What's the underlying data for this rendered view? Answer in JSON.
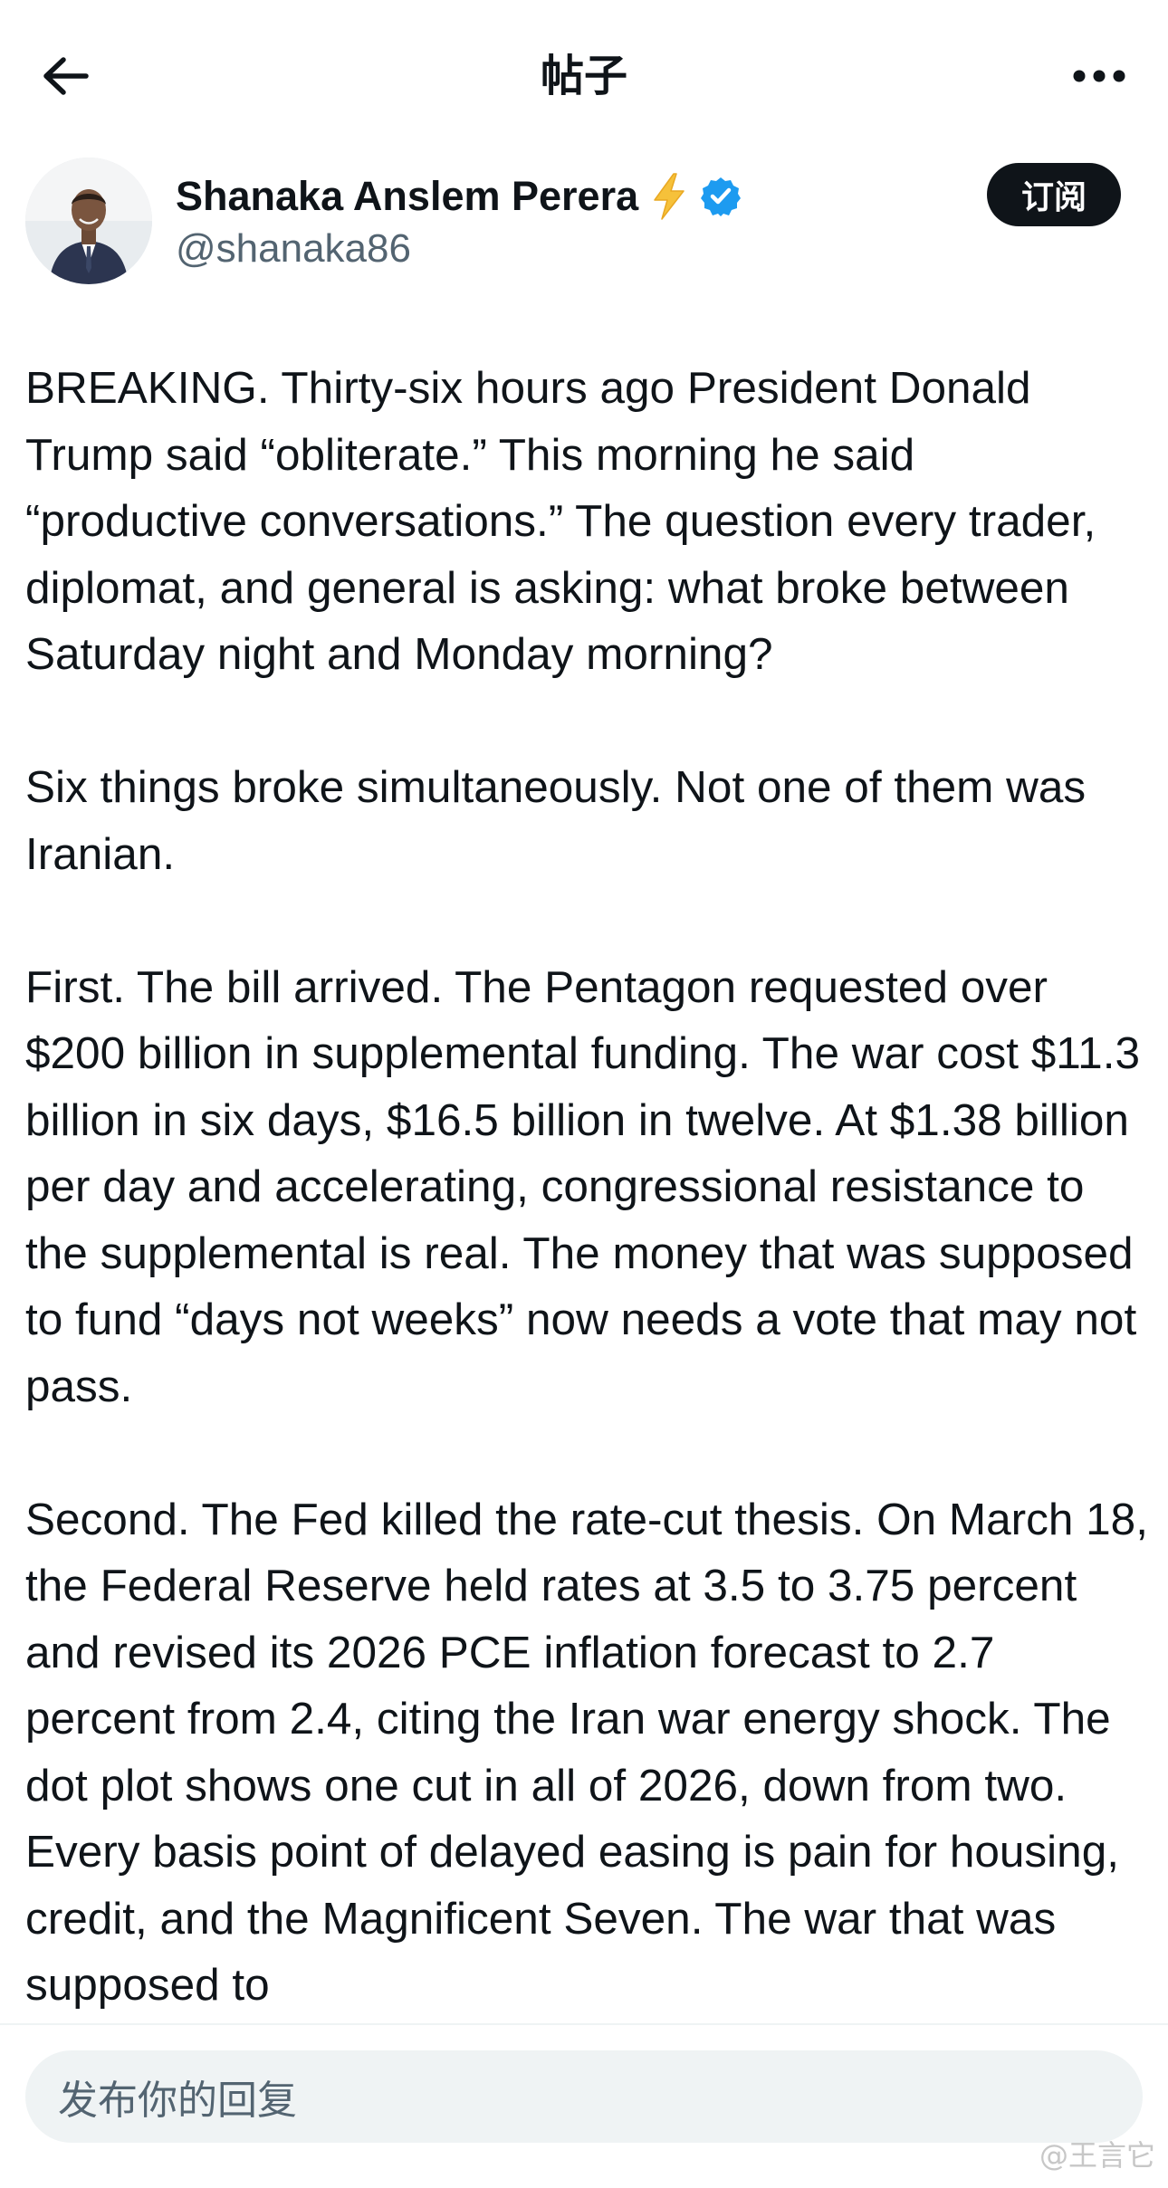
{
  "header": {
    "title": "帖子",
    "back_icon": "arrow-left-icon",
    "more_icon": "more-horizontal-icon"
  },
  "author": {
    "name": "Shanaka Anslem Perera",
    "handle": "@shanaka86",
    "emoji": "⚡",
    "verified_icon": "verified-badge-icon",
    "verified_color": "#1d9bf0"
  },
  "subscribe_label": "订阅",
  "post": {
    "paragraphs": [
      "BREAKING. Thirty-six hours ago President Donald Trump said “obliterate.” This morning he said “productive conversations.” The question every trader, diplomat, and general is asking: what broke between Saturday night and Monday morning?",
      "Six things broke simultaneously. Not one of them was Iranian.",
      "First. The bill arrived. The Pentagon requested over $200 billion in supplemental funding. The war cost $11.3 billion in six days, $16.5 billion in twelve. At $1.38 billion per day and accelerating, congressional resistance to the supplemental is real. The money that was supposed to fund “days not weeks” now needs a vote that may not pass.",
      "Second. The Fed killed the rate-cut thesis. On March 18, the Federal Reserve held rates at 3.5 to 3.75 percent and revised its 2026 PCE inflation forecast to 2.7 percent from 2.4, citing the Iran war energy shock. The dot plot shows one cut in all of 2026, down from two. Every basis point of delayed easing is pain for housing, credit, and the Magnificent Seven. The war that was supposed to"
    ]
  },
  "reply": {
    "placeholder": "发布你的回复"
  },
  "watermark": "@王言它",
  "colors": {
    "text": "#0f1419",
    "secondary": "#536471",
    "accent": "#1d9bf0",
    "reply_bg": "#eff3f4"
  }
}
